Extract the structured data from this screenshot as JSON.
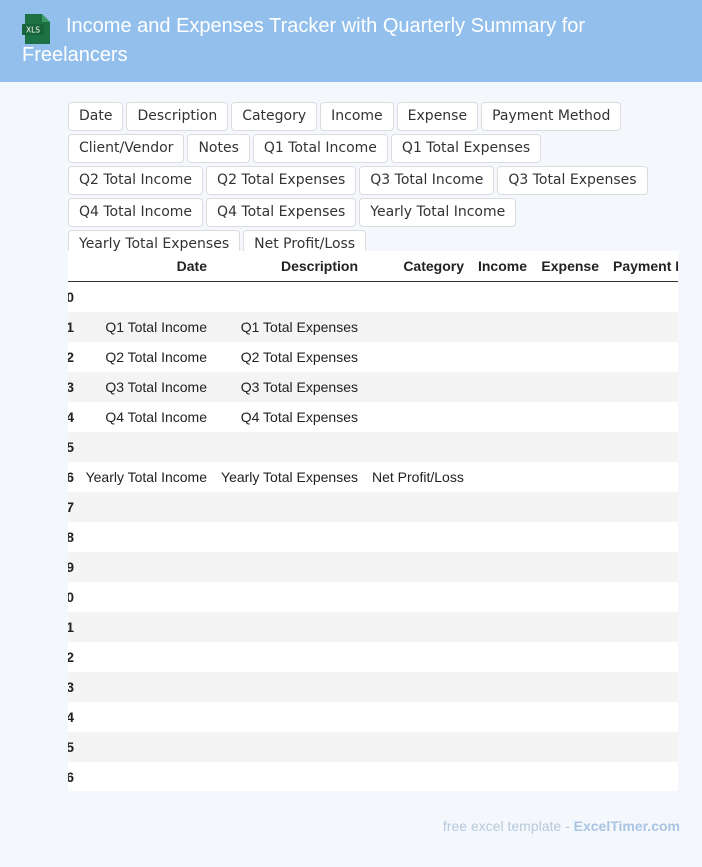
{
  "header": {
    "title": "Income and Expenses Tracker with Quarterly Summary for Freelancers",
    "icon_label": "XLS",
    "icon_color": "#1d7245"
  },
  "tags": [
    "Date",
    "Description",
    "Category",
    "Income",
    "Expense",
    "Payment Method",
    "Client/Vendor",
    "Notes",
    "Q1 Total Income",
    "Q1 Total Expenses",
    "Q2 Total Income",
    "Q2 Total Expenses",
    "Q3 Total Income",
    "Q3 Total Expenses",
    "Q4 Total Income",
    "Q4 Total Expenses",
    "Yearly Total Income",
    "Yearly Total Expenses",
    "Net Profit/Loss"
  ],
  "sheet": {
    "headers": [
      "Date",
      "Description",
      "Category",
      "Income",
      "Expense",
      "Payment M"
    ],
    "row_numbers": [
      "0",
      "1",
      "2",
      "3",
      "4",
      "5",
      "6",
      "7",
      "8",
      "9",
      "0",
      "1",
      "2",
      "3",
      "4",
      "5",
      "6"
    ],
    "rows": [
      [
        "",
        "",
        ""
      ],
      [
        "Q1 Total Income",
        "Q1 Total Expenses",
        ""
      ],
      [
        "Q2 Total Income",
        "Q2 Total Expenses",
        ""
      ],
      [
        "Q3 Total Income",
        "Q3 Total Expenses",
        ""
      ],
      [
        "Q4 Total Income",
        "Q4 Total Expenses",
        ""
      ],
      [
        "",
        "",
        ""
      ],
      [
        "Yearly Total Income",
        "Yearly Total Expenses",
        "Net Profit/Loss"
      ],
      [
        "",
        "",
        ""
      ],
      [
        "",
        "",
        ""
      ],
      [
        "",
        "",
        ""
      ],
      [
        "",
        "",
        ""
      ],
      [
        "",
        "",
        ""
      ],
      [
        "",
        "",
        ""
      ],
      [
        "",
        "",
        ""
      ],
      [
        "",
        "",
        ""
      ],
      [
        "",
        "",
        ""
      ],
      [
        "",
        "",
        ""
      ]
    ]
  },
  "footer": {
    "prefix": "free excel template - ",
    "brand": "ExcelTimer.com"
  }
}
